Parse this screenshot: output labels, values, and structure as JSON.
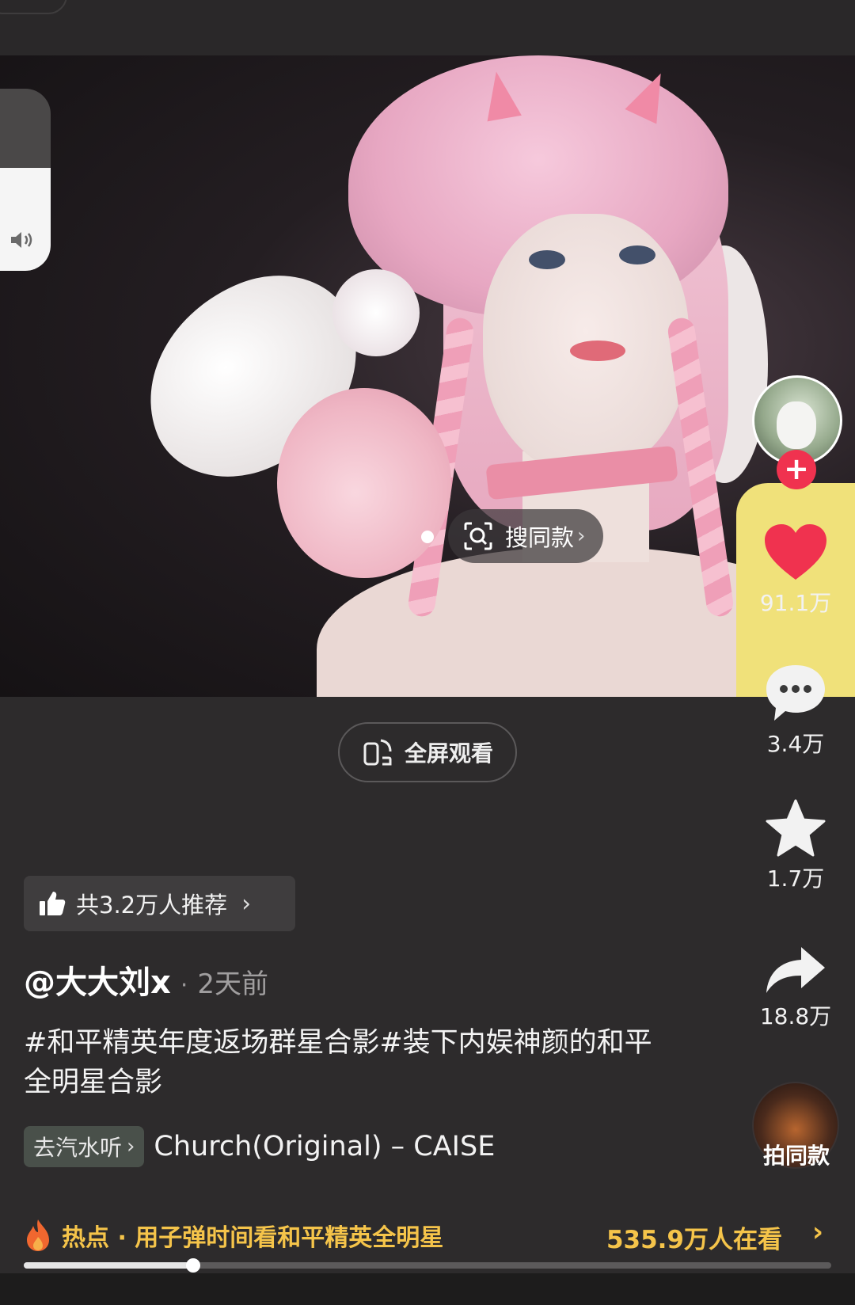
{
  "video": {
    "search_same_label": "搜同款",
    "search_same_chevron": "›",
    "fullscreen_label": "全屏观看",
    "progress_fraction": 0.21
  },
  "actions": {
    "likes": "91.1万",
    "comments": "3.4万",
    "favorites": "1.7万",
    "shares": "18.8万",
    "shoot_same": "拍同款",
    "like_color": "#f0324f",
    "follow_icon": "+"
  },
  "recommend": {
    "label": "共3.2万人推荐",
    "chevron": "›"
  },
  "author": {
    "name": "@大大刘x",
    "dot": "·",
    "time": "2天前"
  },
  "caption": "#和平精英年度返场群星合影#装下内娱神颜的和平全明星合影",
  "music": {
    "soda_label": "去汽水听",
    "soda_chevron": "›",
    "title": "Church(Original) – CAISE"
  },
  "hot": {
    "label": "热点 · 用子弹时间看和平精英全明星",
    "viewers": "535.9万人在看",
    "chevron": "›",
    "accent_color": "#f5c44a"
  }
}
